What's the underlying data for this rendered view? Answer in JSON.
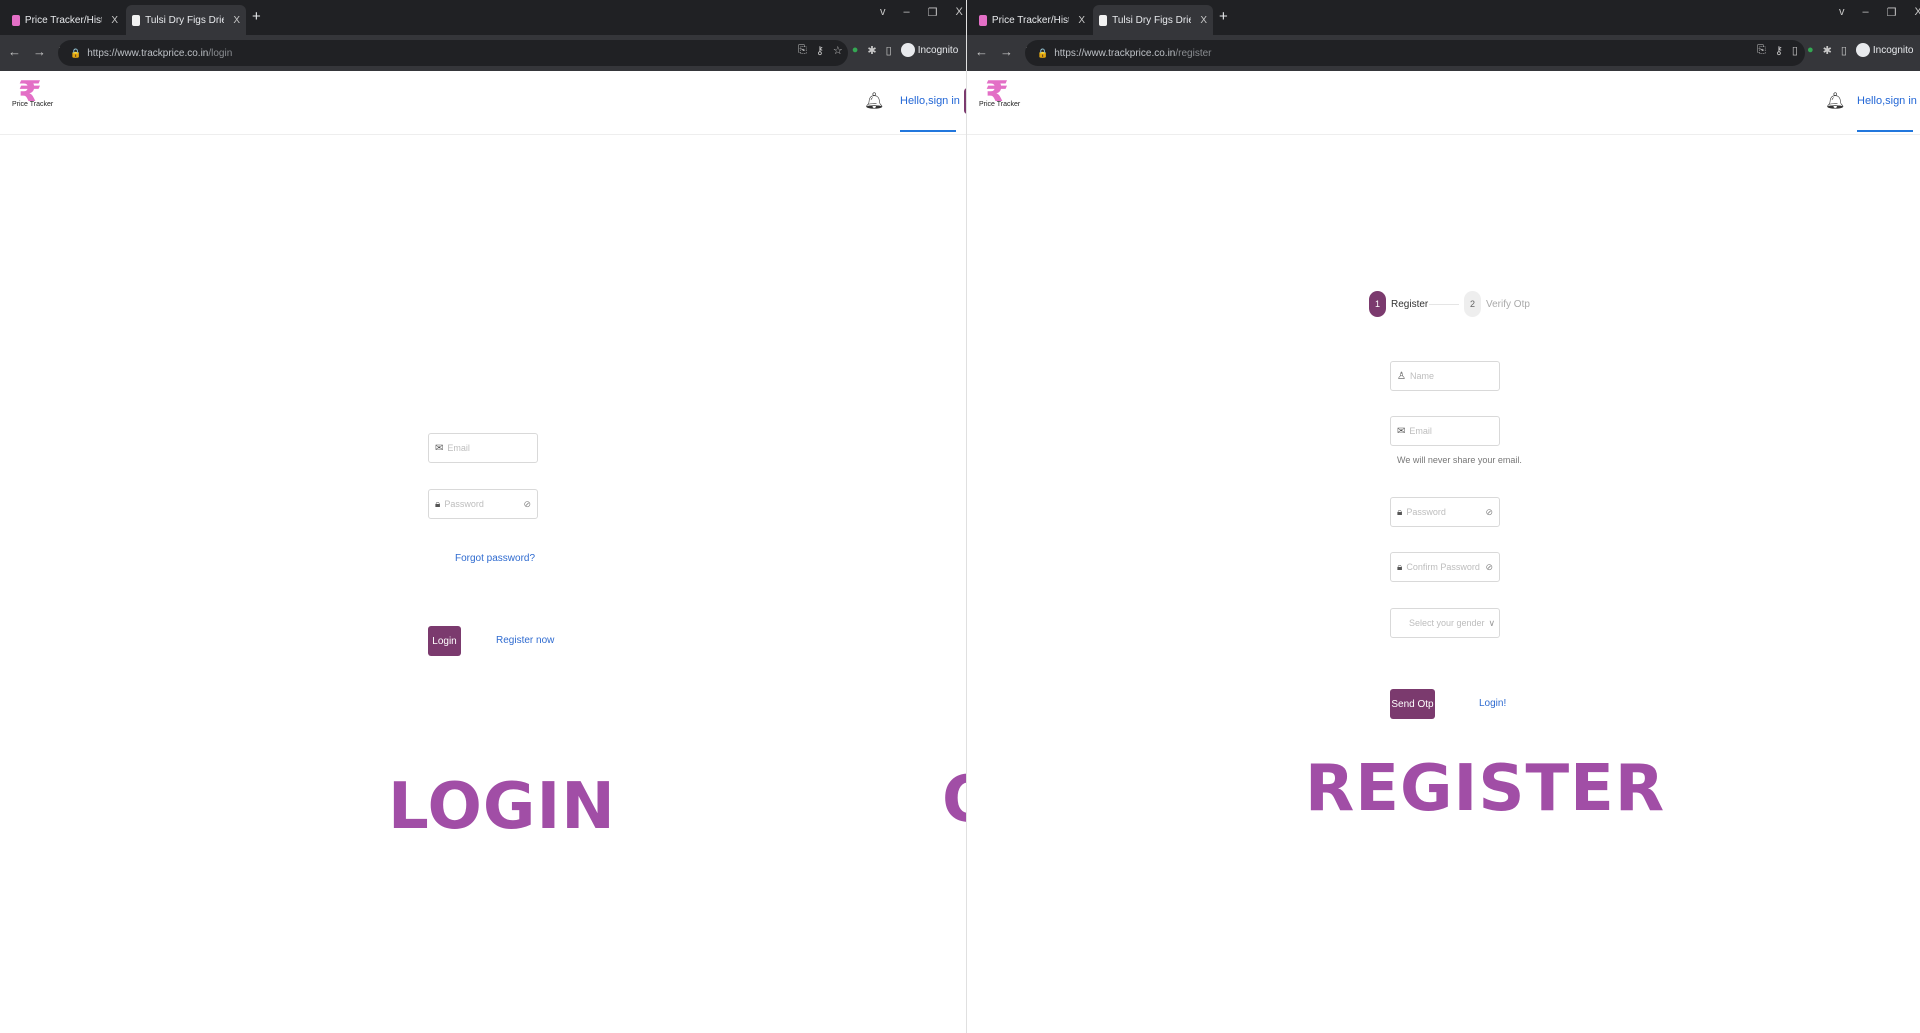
{
  "left": {
    "tabs": [
      {
        "title": "Price Tracker/History for Amazon",
        "close": "X"
      },
      {
        "title": "Tulsi Dry Figs Dried Anjeer Zaki",
        "close": "X"
      }
    ],
    "new_tab": "+",
    "window_controls": [
      "v",
      "–",
      "❐",
      "X"
    ],
    "url_host": "https://www.trackprice.co.in",
    "url_path": "/login",
    "incognito": "Incognito"
  },
  "right": {
    "tabs": [
      {
        "title": "Price Tracker/History for Amazon",
        "close": "X"
      },
      {
        "title": "Tulsi Dry Figs Dried Anjeer Zaki",
        "close": "X"
      }
    ],
    "new_tab": "+",
    "window_controls": [
      "v",
      "–",
      "❐",
      "X"
    ],
    "url_host": "https://www.trackprice.co.in",
    "url_path": "/register",
    "incognito": "Incognito"
  },
  "app": {
    "brand": "Price Tracker",
    "logo_symbol": "₹",
    "hello": "Hello,sign in"
  },
  "login": {
    "email_placeholder": "Email",
    "password_placeholder": "Password",
    "forgot": "Forgot password?",
    "login_button": "Login",
    "register_link": "Register now"
  },
  "register": {
    "steps": [
      {
        "num": "1",
        "label": "Register"
      },
      {
        "num": "2",
        "label": "Verify Otp"
      }
    ],
    "name_placeholder": "Name",
    "email_placeholder": "Email",
    "email_help": "We will never share your email.",
    "password_placeholder": "Password",
    "confirm_placeholder": "Confirm Password",
    "gender_placeholder": "Select your gender",
    "send_button": "Send Otp",
    "login_link": "Login!"
  },
  "captions": {
    "login": "LOGIN",
    "or": "OR",
    "register": "REGISTER"
  },
  "colors": {
    "brand_purple": "#7b3a6e",
    "caption_purple": "#a14ea6",
    "link_blue": "#2f6bd0",
    "logo_pink": "#e36fc6"
  }
}
